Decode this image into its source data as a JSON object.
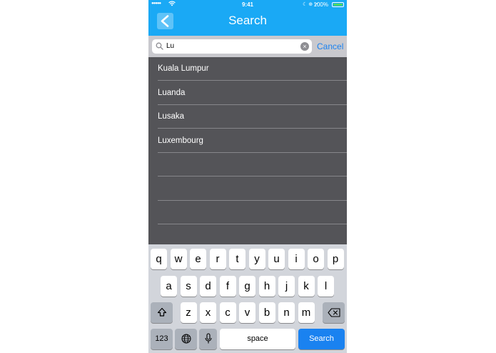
{
  "status_bar": {
    "signal": "●●●●●",
    "time": "9:41",
    "battery_percent": "100%",
    "battery_level": 1.0
  },
  "nav": {
    "title": "Search",
    "back_icon": "chevron-left-icon"
  },
  "search": {
    "value": "Lu",
    "cancel_label": "Cancel"
  },
  "results": [
    "Kuala Lumpur",
    "Luanda",
    "Lusaka",
    "Luxembourg"
  ],
  "keyboard": {
    "row1": [
      "q",
      "w",
      "e",
      "r",
      "t",
      "y",
      "u",
      "i",
      "o",
      "p"
    ],
    "row2": [
      "a",
      "s",
      "d",
      "f",
      "g",
      "h",
      "j",
      "k",
      "l"
    ],
    "row3": [
      "z",
      "x",
      "c",
      "v",
      "b",
      "n",
      "m"
    ],
    "numbers_label": "123",
    "space_label": "space",
    "search_label": "Search"
  },
  "colors": {
    "nav_bar": "#1aa9f5",
    "list_bg": "#545458",
    "accent": "#1a82f0"
  }
}
